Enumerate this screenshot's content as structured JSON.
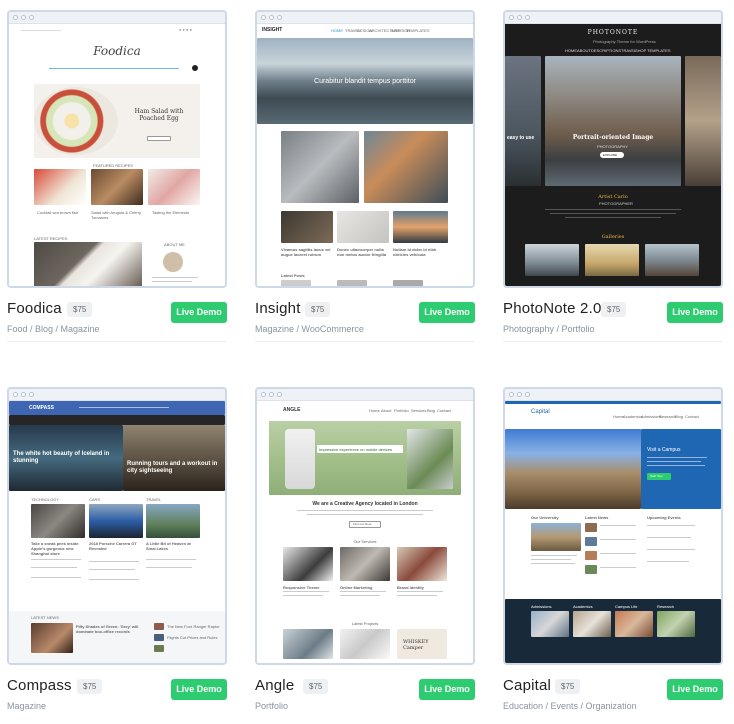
{
  "themes": [
    {
      "name": "Foodica",
      "price": "$75",
      "categories": "Food / Blog / Magazine",
      "demo_label": "Live Demo",
      "preview": {
        "logo": "Foodica",
        "slide_title": "Ham Salad with Poached Egg",
        "section": "FEATURED RECIPES",
        "recipes": [
          "Cocktail sea brown fish",
          "Salad with Arugula & Cherry Tomatoes",
          "Tasting the Elements"
        ],
        "latest": "LATEST RECIPES",
        "about": "ABOUT ME"
      }
    },
    {
      "name": "Insight",
      "price": "$75",
      "categories": "Magazine / WooCommerce",
      "demo_label": "Live Demo",
      "preview": {
        "logo": "INSIGHT",
        "nav": [
          "HOME",
          "TRAVEL",
          "DESIGN",
          "ARCHITECTURE",
          "INTERIOR",
          "TEMPLATES"
        ],
        "hero": "Curabitur blandit tempus porttitor",
        "posts": [
          "Vivamus sagittis lacus vel augue laoreet rutrum",
          "Donec ullamcorper nulla non metus auctor fringilla",
          "Nullam id dolor id nibh ultricies vehicula"
        ],
        "section": "Latest Posts"
      }
    },
    {
      "name": "PhotoNote 2.0",
      "price": "$75",
      "categories": "Photography / Portfolio",
      "demo_label": "Live Demo",
      "preview": {
        "logo": "PHOTONOTE",
        "tagline": "Photography Theme for WordPress",
        "nav": [
          "HOME",
          "ABOUT",
          "DESCRIPTIONS",
          "TRAVEL",
          "SHOP",
          "TEMPLATES"
        ],
        "side_caption": "easy to use",
        "hero": "Portrait-oriented Image",
        "sub": "PHOTOGRAPHY",
        "button": "EXPLORE",
        "artist": "Artist Carlo",
        "artist_role": "PHOTOGRAPHER",
        "galleries": "Galleries"
      }
    },
    {
      "name": "Compass",
      "price": "$75",
      "categories": "Magazine",
      "demo_label": "Live Demo",
      "preview": {
        "logo": "COMPASS",
        "hero_left": "The white hot beauty of Iceland in stunning",
        "hero_right": "Running tours and a workout in city sightseeing",
        "cols": [
          "TECHNOLOGY",
          "CARS",
          "TRAVEL"
        ],
        "posts": [
          "Take a sneak peek inside Apple's gorgeous new Shanghai store",
          "2018 Porsche Carrera GT Revealed",
          "A Little Bit of Heaven at Sinai Lakes"
        ],
        "latest": "LATEST NEWS",
        "latest_items": [
          "Fifty Shades of Green: 'Grey' will dominate box-office records",
          "The New Ford Ranger Raptor",
          "Flights Cut Prices and Rules"
        ]
      }
    },
    {
      "name": "Angle",
      "price": "$75",
      "categories": "Portfolio",
      "demo_label": "Live Demo",
      "preview": {
        "logo": "ANGLE",
        "nav": [
          "Home",
          "About",
          "Portfolio",
          "Services",
          "Blog",
          "Contact"
        ],
        "banner": "Impressive experience on mobile devices",
        "headline": "We are a Creative Agency located in London",
        "button": "Find out More",
        "services": "Our Services",
        "items": [
          "Responsive Theme",
          "Online Marketing",
          "Brand Identity"
        ],
        "clients": "Latest Projects",
        "logo_text": "WHISKEY Camper"
      }
    },
    {
      "name": "Capital",
      "price": "$75",
      "categories": "Education / Events / Organization",
      "demo_label": "Live Demo",
      "preview": {
        "logo": "Capital",
        "nav": [
          "Home",
          "Academics",
          "Admissions",
          "Research",
          "Blog",
          "Contact"
        ],
        "cta_title": "Visit a Campus",
        "cta_button": "Start Tour",
        "cols": [
          "Our University",
          "Latest News",
          "Upcoming Events"
        ],
        "footer": [
          "Admissions",
          "Academics",
          "Campus Life",
          "Research"
        ]
      }
    }
  ],
  "colors": {
    "accent": "#2ecc71",
    "border": "#cfd8e6",
    "muted": "#8a94a0"
  }
}
